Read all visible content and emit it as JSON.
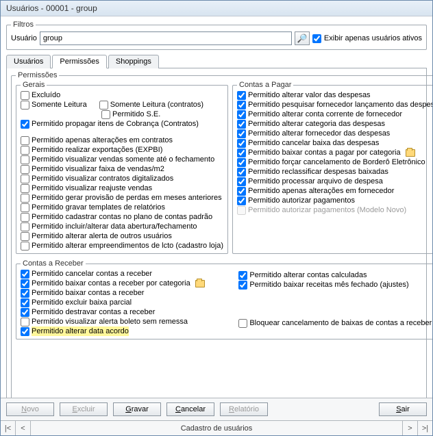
{
  "title": "Usuários - 00001 - group",
  "filtros": {
    "legend": "Filtros",
    "usuario_label": "Usuário",
    "usuario_value": "group",
    "exibir_ativos": "Exibir apenas usuários ativos"
  },
  "tabs": {
    "usuarios": "Usuários",
    "permissoes": "Permissões",
    "shoppings": "Shoppings"
  },
  "perm_legend": "Permissões",
  "gerais": {
    "legend": "Gerais",
    "excluido": "Excluído",
    "somente_leitura": "Somente Leitura",
    "somente_leitura_contratos": "Somente Leitura (contratos)",
    "permitido_se": "Permitido S.E.",
    "propagar_cobranca": "Permitido propagar itens de Cobrança (Contratos)",
    "alt_contratos": "Permitido apenas alterações em contratos",
    "exportacoes": "Permitido realizar exportações (EXPBI)",
    "visualizar_vendas_fechamento": "Permitido visualizar vendas somente até o fechamento",
    "visualizar_faixa": "Permitido visualizar faixa de vendas/m2",
    "visualizar_contratos_dig": "Permitido visualizar contratos digitalizados",
    "visualizar_reajuste": "Permitido visualizar reajuste vendas",
    "gerar_provisao": "Permitido gerar provisão de perdas em meses anteriores",
    "gravar_templates": "Permitido gravar templates de relatórios",
    "cadastrar_contas_plano": "Permitido cadastrar contas no plano de contas padrão",
    "incluir_alterar_data": "Permitido incluir/alterar data abertura/fechamento",
    "alterar_alerta": "Permitido alterar alerta de outros usuários",
    "alterar_empreend": "Permitido alterar empreendimentos de lcto (cadastro loja)"
  },
  "pagar": {
    "legend": "Contas a Pagar",
    "alterar_valor": "Permitido alterar valor das despesas",
    "pesquisar_fornecedor": "Permitido pesquisar fornecedor lançamento das despesas",
    "alterar_conta_corrente": "Permitido alterar conta corrente de fornecedor",
    "alterar_categoria": "Permitido alterar categoria das despesas",
    "alterar_fornecedor": "Permitido alterar fornecedor das despesas",
    "cancelar_baixa": "Permitido cancelar baixa das despesas",
    "baixar_categoria": "Permitido baixar contas a pagar por categoria",
    "forcar_cancelamento": "Permitido forçar cancelamento de Borderô Eletrônico",
    "reclassificar": "Permitido reclassificar despesas baixadas",
    "processar_arquivo": "Permitido processar arquivo de despesa",
    "alt_fornecedor": "Permitido apenas alterações em fornecedor",
    "autorizar_pag": "Permitido autorizar pagamentos",
    "autorizar_pag_novo": "Permitido autorizar pagamentos (Modelo Novo)"
  },
  "receber": {
    "legend": "Contas a Receber",
    "cancelar": "Permitido cancelar contas a receber",
    "baixar_categoria": "Permitido baixar contas a receber por categoria",
    "baixar": "Permitido baixar contas a receber",
    "excluir_baixa": "Permitido excluir baixa parcial",
    "destravar": "Permitido destravar contas a receber",
    "visualizar_alerta_boleto": "Permitido visualizar alerta boleto sem remessa",
    "alterar_data_acordo": "Permitido alterar data acordo",
    "alterar_calculadas": "Permitido alterar contas calculadas",
    "baixar_receitas_mes": "Permitido baixar receitas mês fechado (ajustes)",
    "bloquear_cancel": "Bloquear cancelamento de baixas de contas a receber"
  },
  "buttons": {
    "novo": "Novo",
    "excluir": "Excluir",
    "gravar": "Gravar",
    "cancelar": "Cancelar",
    "relatorio": "Relatório",
    "sair": "Sair"
  },
  "status": "Cadastro de usuários"
}
